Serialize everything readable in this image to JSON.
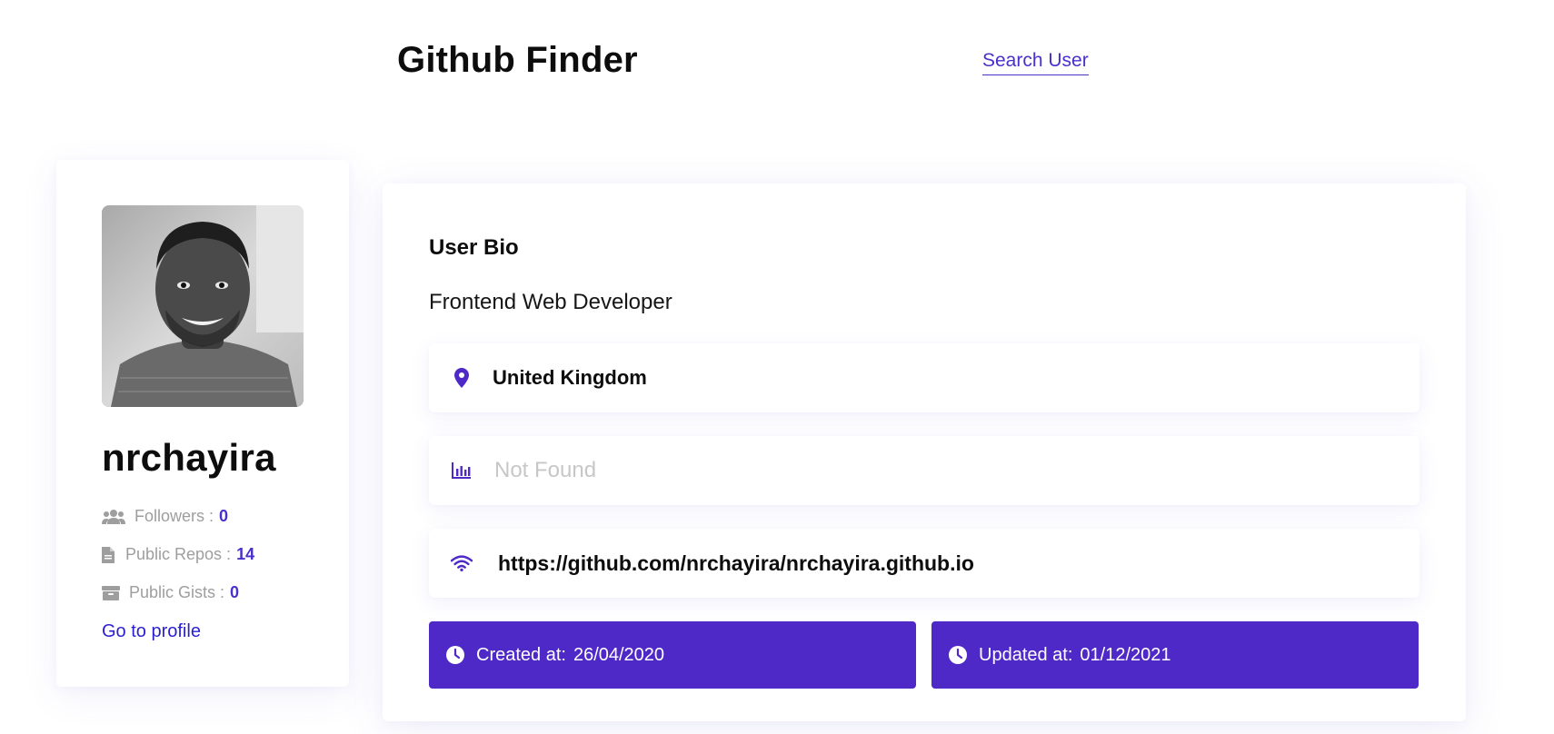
{
  "header": {
    "title": "Github Finder",
    "nav_link": "Search User"
  },
  "profile": {
    "username": "nrchayira",
    "avatar_alt": "User avatar",
    "stats": {
      "followers_label": "Followers :",
      "followers_value": "0",
      "repos_label": "Public Repos :",
      "repos_value": "14",
      "gists_label": "Public Gists :",
      "gists_value": "0"
    },
    "profile_link": "Go to profile"
  },
  "bio": {
    "heading": "User Bio",
    "text": "Frontend Web Developer",
    "location": "United Kingdom",
    "company": "Not Found",
    "blog": "https://github.com/nrchayira/nrchayira.github.io",
    "created_label": "Created at:",
    "created_value": "26/04/2020",
    "updated_label": "Updated at:",
    "updated_value": "01/12/2021"
  },
  "icons": {
    "followers": "users-icon",
    "repos": "file-icon",
    "gists": "archive-icon",
    "location": "map-pin-icon",
    "company": "chart-icon",
    "blog": "wifi-icon",
    "clock": "clock-icon"
  },
  "colors": {
    "accent": "#4e29c8",
    "link": "#4a2fcc",
    "muted": "#9e9e9e",
    "placeholder": "#c7c7c7"
  }
}
